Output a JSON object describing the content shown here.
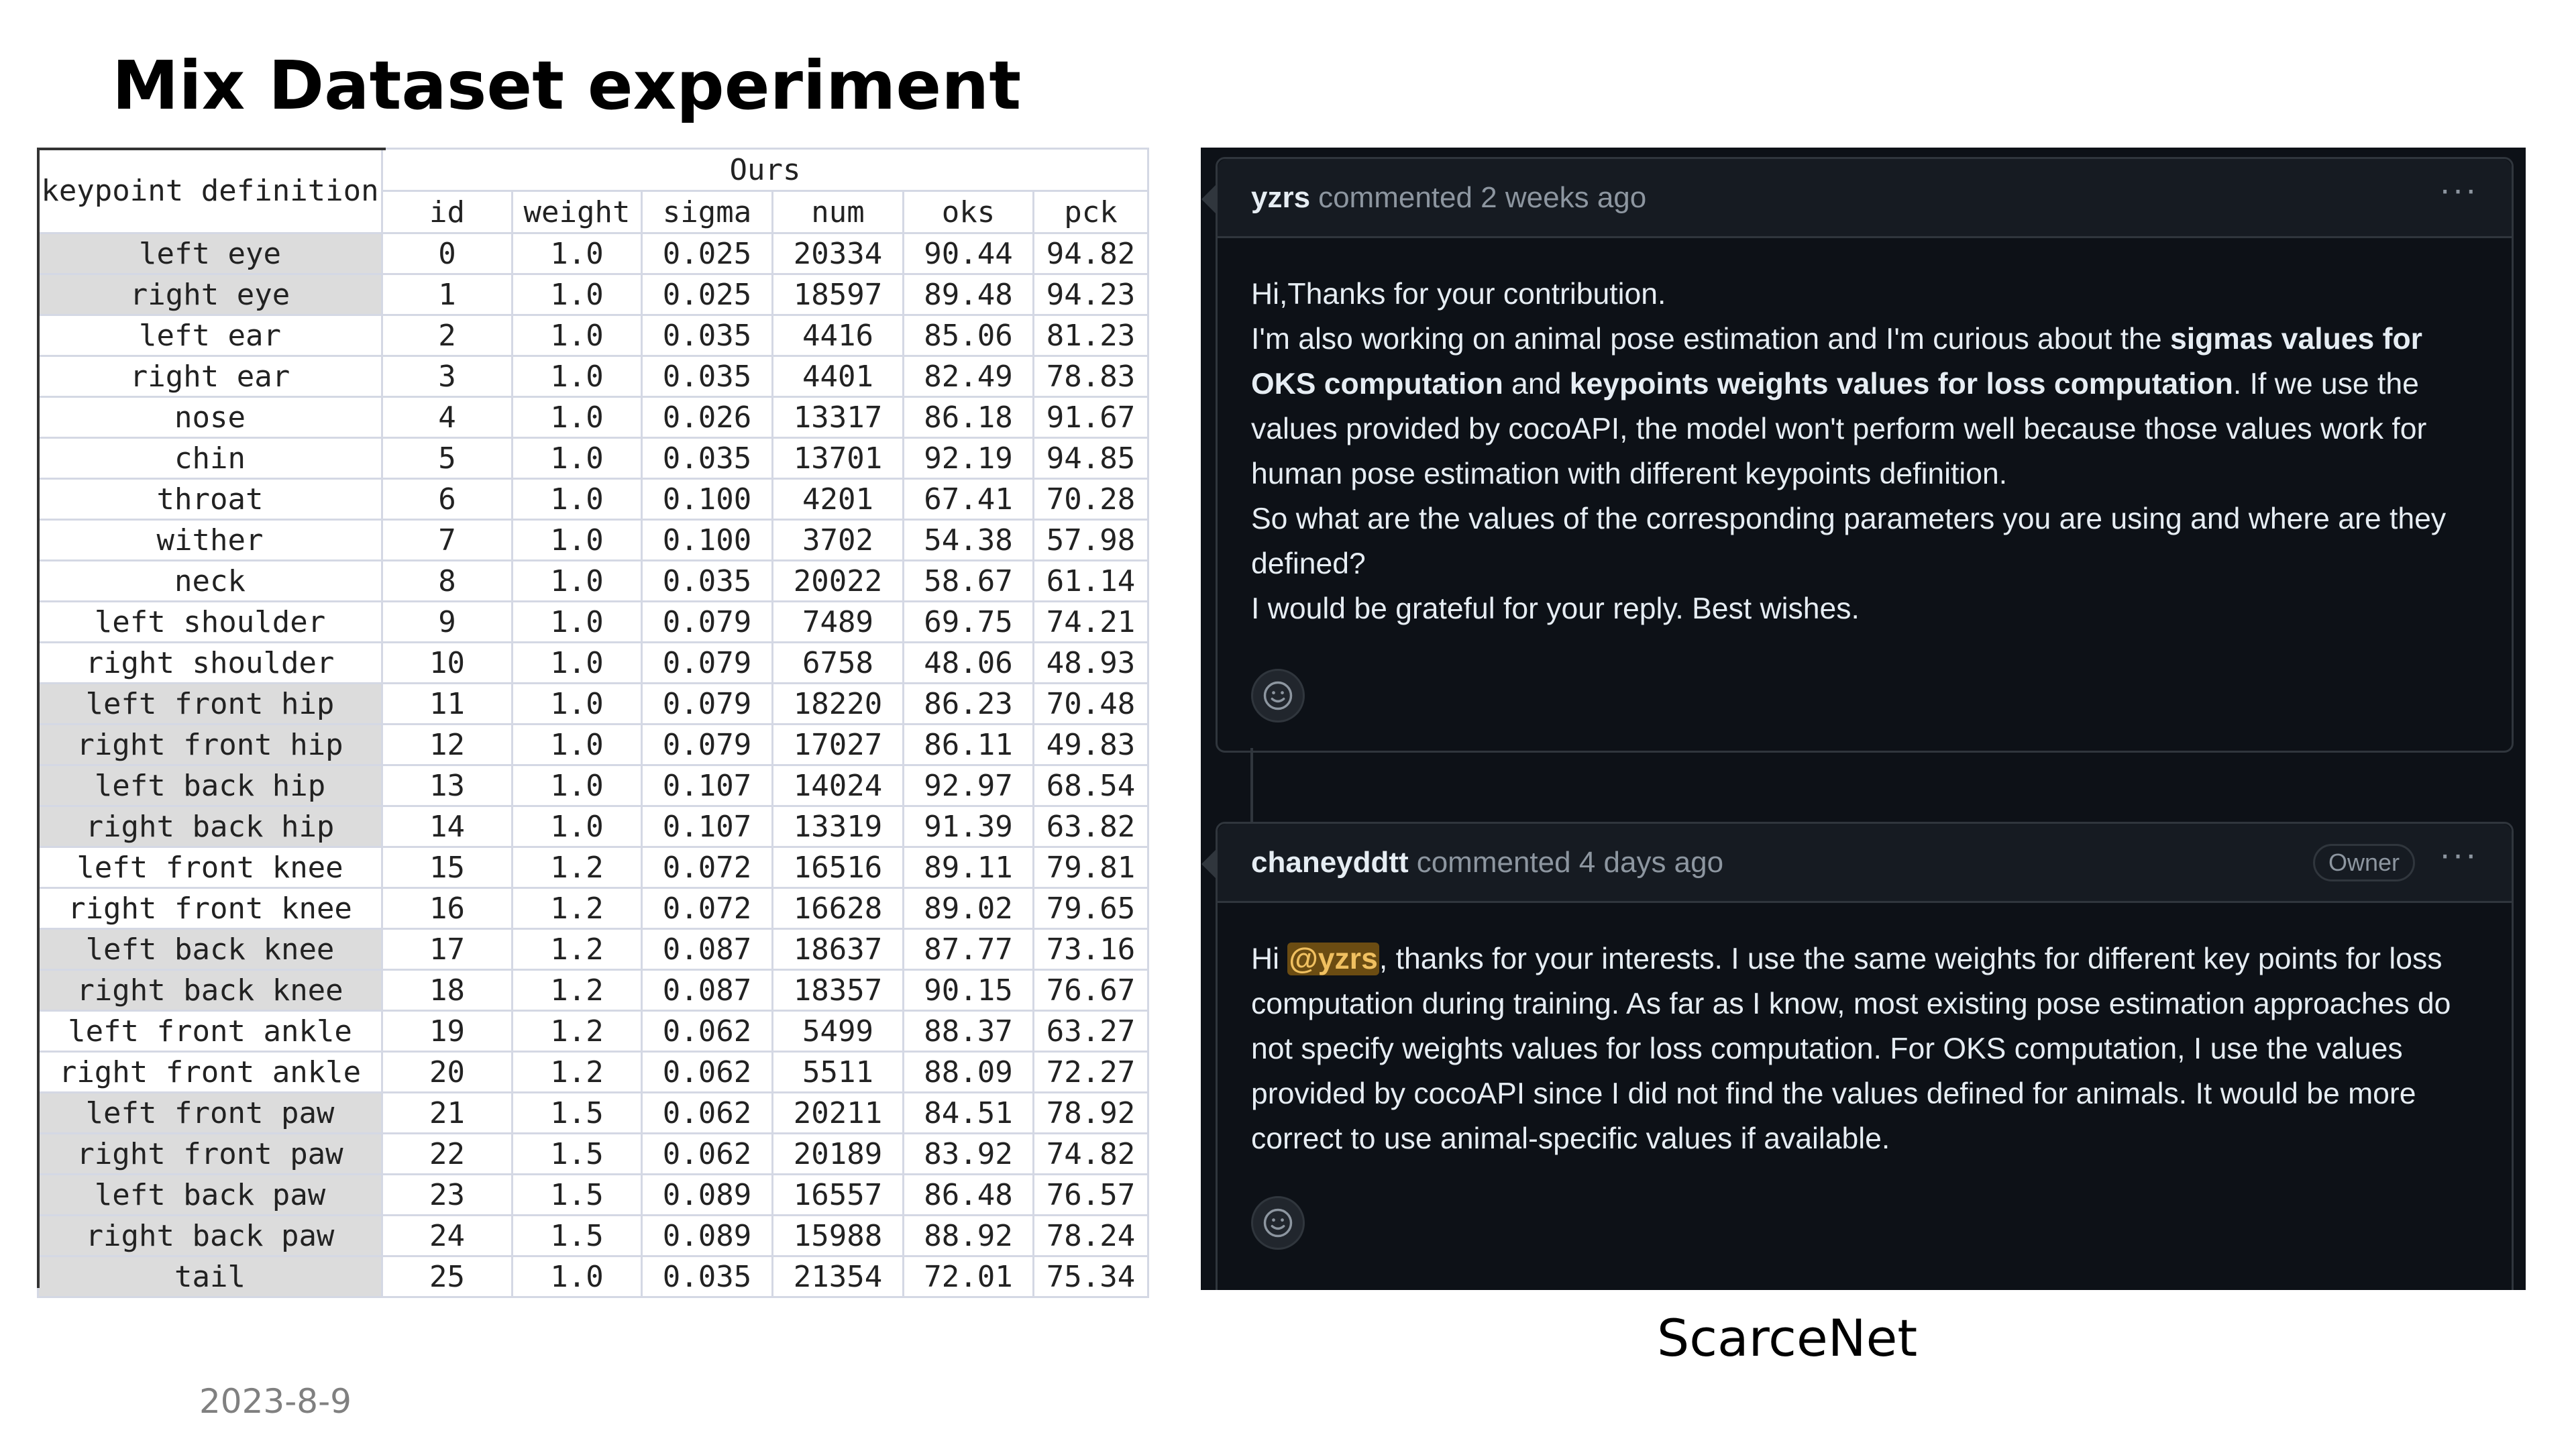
{
  "slide": {
    "title": "Mix Dataset experiment",
    "caption": "ScarceNet",
    "date": "2023-8-9"
  },
  "table": {
    "name_header": "keypoint definition",
    "group_header": "Ours",
    "columns": [
      "id",
      "weight",
      "sigma",
      "num",
      "oks",
      "pck"
    ],
    "rows": [
      {
        "name": "left eye",
        "shaded": true,
        "id": "0",
        "weight": "1.0",
        "sigma": "0.025",
        "num": "20334",
        "oks": "90.44",
        "pck": "94.82"
      },
      {
        "name": "right eye",
        "shaded": true,
        "id": "1",
        "weight": "1.0",
        "sigma": "0.025",
        "num": "18597",
        "oks": "89.48",
        "pck": "94.23"
      },
      {
        "name": "left ear",
        "shaded": false,
        "id": "2",
        "weight": "1.0",
        "sigma": "0.035",
        "num": "4416",
        "oks": "85.06",
        "pck": "81.23"
      },
      {
        "name": "right ear",
        "shaded": false,
        "id": "3",
        "weight": "1.0",
        "sigma": "0.035",
        "num": "4401",
        "oks": "82.49",
        "pck": "78.83"
      },
      {
        "name": "nose",
        "shaded": false,
        "id": "4",
        "weight": "1.0",
        "sigma": "0.026",
        "num": "13317",
        "oks": "86.18",
        "pck": "91.67"
      },
      {
        "name": "chin",
        "shaded": false,
        "id": "5",
        "weight": "1.0",
        "sigma": "0.035",
        "num": "13701",
        "oks": "92.19",
        "pck": "94.85"
      },
      {
        "name": "throat",
        "shaded": false,
        "id": "6",
        "weight": "1.0",
        "sigma": "0.100",
        "num": "4201",
        "oks": "67.41",
        "pck": "70.28"
      },
      {
        "name": "wither",
        "shaded": false,
        "id": "7",
        "weight": "1.0",
        "sigma": "0.100",
        "num": "3702",
        "oks": "54.38",
        "pck": "57.98"
      },
      {
        "name": "neck",
        "shaded": false,
        "id": "8",
        "weight": "1.0",
        "sigma": "0.035",
        "num": "20022",
        "oks": "58.67",
        "pck": "61.14"
      },
      {
        "name": "left shoulder",
        "shaded": false,
        "id": "9",
        "weight": "1.0",
        "sigma": "0.079",
        "num": "7489",
        "oks": "69.75",
        "pck": "74.21"
      },
      {
        "name": "right shoulder",
        "shaded": false,
        "id": "10",
        "weight": "1.0",
        "sigma": "0.079",
        "num": "6758",
        "oks": "48.06",
        "pck": "48.93"
      },
      {
        "name": "left front hip",
        "shaded": true,
        "id": "11",
        "weight": "1.0",
        "sigma": "0.079",
        "num": "18220",
        "oks": "86.23",
        "pck": "70.48"
      },
      {
        "name": "right front hip",
        "shaded": true,
        "id": "12",
        "weight": "1.0",
        "sigma": "0.079",
        "num": "17027",
        "oks": "86.11",
        "pck": "49.83"
      },
      {
        "name": "left back hip",
        "shaded": true,
        "id": "13",
        "weight": "1.0",
        "sigma": "0.107",
        "num": "14024",
        "oks": "92.97",
        "pck": "68.54"
      },
      {
        "name": "right back hip",
        "shaded": true,
        "id": "14",
        "weight": "1.0",
        "sigma": "0.107",
        "num": "13319",
        "oks": "91.39",
        "pck": "63.82"
      },
      {
        "name": "left front knee",
        "shaded": false,
        "id": "15",
        "weight": "1.2",
        "sigma": "0.072",
        "num": "16516",
        "oks": "89.11",
        "pck": "79.81"
      },
      {
        "name": "right front knee",
        "shaded": false,
        "id": "16",
        "weight": "1.2",
        "sigma": "0.072",
        "num": "16628",
        "oks": "89.02",
        "pck": "79.65"
      },
      {
        "name": "left back knee",
        "shaded": true,
        "id": "17",
        "weight": "1.2",
        "sigma": "0.087",
        "num": "18637",
        "oks": "87.77",
        "pck": "73.16"
      },
      {
        "name": "right back knee",
        "shaded": true,
        "id": "18",
        "weight": "1.2",
        "sigma": "0.087",
        "num": "18357",
        "oks": "90.15",
        "pck": "76.67"
      },
      {
        "name": "left front ankle",
        "shaded": false,
        "id": "19",
        "weight": "1.2",
        "sigma": "0.062",
        "num": "5499",
        "oks": "88.37",
        "pck": "63.27"
      },
      {
        "name": "right front ankle",
        "shaded": false,
        "id": "20",
        "weight": "1.2",
        "sigma": "0.062",
        "num": "5511",
        "oks": "88.09",
        "pck": "72.27"
      },
      {
        "name": "left front paw",
        "shaded": true,
        "id": "21",
        "weight": "1.5",
        "sigma": "0.062",
        "num": "20211",
        "oks": "84.51",
        "pck": "78.92"
      },
      {
        "name": "right front paw",
        "shaded": true,
        "id": "22",
        "weight": "1.5",
        "sigma": "0.062",
        "num": "20189",
        "oks": "83.92",
        "pck": "74.82"
      },
      {
        "name": "left back paw",
        "shaded": true,
        "id": "23",
        "weight": "1.5",
        "sigma": "0.089",
        "num": "16557",
        "oks": "86.48",
        "pck": "76.57"
      },
      {
        "name": "right back paw",
        "shaded": true,
        "id": "24",
        "weight": "1.5",
        "sigma": "0.089",
        "num": "15988",
        "oks": "88.92",
        "pck": "78.24"
      },
      {
        "name": "tail",
        "shaded": true,
        "id": "25",
        "weight": "1.0",
        "sigma": "0.035",
        "num": "21354",
        "oks": "72.01",
        "pck": "75.34"
      }
    ]
  },
  "github": {
    "colors": {
      "bg": "#0d1117",
      "header": "#161b22",
      "border": "#30363d",
      "text": "#e6edf3",
      "muted": "#8d96a0",
      "mention_bg": "#6b4c12"
    },
    "comment1": {
      "author": "yzrs",
      "meta": "commented 2 weeks ago",
      "menu_icon": "kebab-menu-icon",
      "p1": "Hi,Thanks for your contribution.",
      "p2_a": "I'm also working on animal pose estimation and I'm curious about the ",
      "p2_b": "sigmas values for OKS computation",
      "p2_c": " and ",
      "p2_d": "keypoints weights values for loss computation",
      "p2_e": ". If we use the values provided by cocoAPI, the model won't perform well because those values work for human pose estimation with different keypoints definition.",
      "p3": "So what are the values of the corresponding parameters you are using and where are they defined?",
      "p4": "I would be grateful for your reply. Best wishes.",
      "reaction_icon": "smiley-icon"
    },
    "comment2": {
      "author": "chaneyddtt",
      "meta": "commented 4 days ago",
      "badge": "Owner",
      "menu_icon": "kebab-menu-icon",
      "p1_a": "Hi ",
      "mention": "@yzrs",
      "p1_b": ", thanks for your interests. I use the same weights for different key points for loss computation during training. As far as I know, most existing pose estimation approaches do not specify weights values for loss computation. For OKS computation, I use the values provided by cocoAPI since I did not find the values defined for animals. It would be more correct to use animal-specific values if available.",
      "reaction_icon": "smiley-icon"
    }
  }
}
